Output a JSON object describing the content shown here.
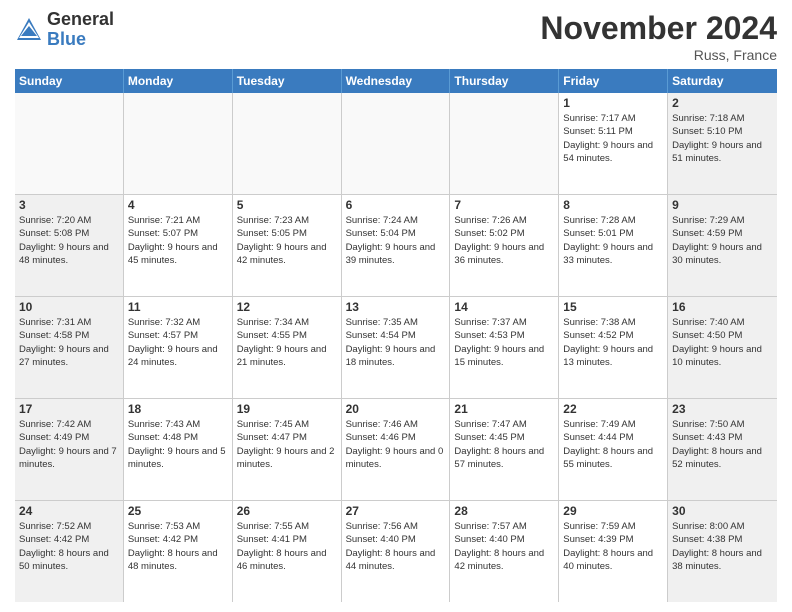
{
  "logo": {
    "general": "General",
    "blue": "Blue"
  },
  "title": "November 2024",
  "location": "Russ, France",
  "header_days": [
    "Sunday",
    "Monday",
    "Tuesday",
    "Wednesday",
    "Thursday",
    "Friday",
    "Saturday"
  ],
  "rows": [
    [
      {
        "day": "",
        "sunrise": "",
        "sunset": "",
        "daylight": "",
        "empty": true
      },
      {
        "day": "",
        "sunrise": "",
        "sunset": "",
        "daylight": "",
        "empty": true
      },
      {
        "day": "",
        "sunrise": "",
        "sunset": "",
        "daylight": "",
        "empty": true
      },
      {
        "day": "",
        "sunrise": "",
        "sunset": "",
        "daylight": "",
        "empty": true
      },
      {
        "day": "",
        "sunrise": "",
        "sunset": "",
        "daylight": "",
        "empty": true
      },
      {
        "day": "1",
        "sunrise": "Sunrise: 7:17 AM",
        "sunset": "Sunset: 5:11 PM",
        "daylight": "Daylight: 9 hours and 54 minutes.",
        "empty": false
      },
      {
        "day": "2",
        "sunrise": "Sunrise: 7:18 AM",
        "sunset": "Sunset: 5:10 PM",
        "daylight": "Daylight: 9 hours and 51 minutes.",
        "empty": false
      }
    ],
    [
      {
        "day": "3",
        "sunrise": "Sunrise: 7:20 AM",
        "sunset": "Sunset: 5:08 PM",
        "daylight": "Daylight: 9 hours and 48 minutes.",
        "empty": false
      },
      {
        "day": "4",
        "sunrise": "Sunrise: 7:21 AM",
        "sunset": "Sunset: 5:07 PM",
        "daylight": "Daylight: 9 hours and 45 minutes.",
        "empty": false
      },
      {
        "day": "5",
        "sunrise": "Sunrise: 7:23 AM",
        "sunset": "Sunset: 5:05 PM",
        "daylight": "Daylight: 9 hours and 42 minutes.",
        "empty": false
      },
      {
        "day": "6",
        "sunrise": "Sunrise: 7:24 AM",
        "sunset": "Sunset: 5:04 PM",
        "daylight": "Daylight: 9 hours and 39 minutes.",
        "empty": false
      },
      {
        "day": "7",
        "sunrise": "Sunrise: 7:26 AM",
        "sunset": "Sunset: 5:02 PM",
        "daylight": "Daylight: 9 hours and 36 minutes.",
        "empty": false
      },
      {
        "day": "8",
        "sunrise": "Sunrise: 7:28 AM",
        "sunset": "Sunset: 5:01 PM",
        "daylight": "Daylight: 9 hours and 33 minutes.",
        "empty": false
      },
      {
        "day": "9",
        "sunrise": "Sunrise: 7:29 AM",
        "sunset": "Sunset: 4:59 PM",
        "daylight": "Daylight: 9 hours and 30 minutes.",
        "empty": false
      }
    ],
    [
      {
        "day": "10",
        "sunrise": "Sunrise: 7:31 AM",
        "sunset": "Sunset: 4:58 PM",
        "daylight": "Daylight: 9 hours and 27 minutes.",
        "empty": false
      },
      {
        "day": "11",
        "sunrise": "Sunrise: 7:32 AM",
        "sunset": "Sunset: 4:57 PM",
        "daylight": "Daylight: 9 hours and 24 minutes.",
        "empty": false
      },
      {
        "day": "12",
        "sunrise": "Sunrise: 7:34 AM",
        "sunset": "Sunset: 4:55 PM",
        "daylight": "Daylight: 9 hours and 21 minutes.",
        "empty": false
      },
      {
        "day": "13",
        "sunrise": "Sunrise: 7:35 AM",
        "sunset": "Sunset: 4:54 PM",
        "daylight": "Daylight: 9 hours and 18 minutes.",
        "empty": false
      },
      {
        "day": "14",
        "sunrise": "Sunrise: 7:37 AM",
        "sunset": "Sunset: 4:53 PM",
        "daylight": "Daylight: 9 hours and 15 minutes.",
        "empty": false
      },
      {
        "day": "15",
        "sunrise": "Sunrise: 7:38 AM",
        "sunset": "Sunset: 4:52 PM",
        "daylight": "Daylight: 9 hours and 13 minutes.",
        "empty": false
      },
      {
        "day": "16",
        "sunrise": "Sunrise: 7:40 AM",
        "sunset": "Sunset: 4:50 PM",
        "daylight": "Daylight: 9 hours and 10 minutes.",
        "empty": false
      }
    ],
    [
      {
        "day": "17",
        "sunrise": "Sunrise: 7:42 AM",
        "sunset": "Sunset: 4:49 PM",
        "daylight": "Daylight: 9 hours and 7 minutes.",
        "empty": false
      },
      {
        "day": "18",
        "sunrise": "Sunrise: 7:43 AM",
        "sunset": "Sunset: 4:48 PM",
        "daylight": "Daylight: 9 hours and 5 minutes.",
        "empty": false
      },
      {
        "day": "19",
        "sunrise": "Sunrise: 7:45 AM",
        "sunset": "Sunset: 4:47 PM",
        "daylight": "Daylight: 9 hours and 2 minutes.",
        "empty": false
      },
      {
        "day": "20",
        "sunrise": "Sunrise: 7:46 AM",
        "sunset": "Sunset: 4:46 PM",
        "daylight": "Daylight: 9 hours and 0 minutes.",
        "empty": false
      },
      {
        "day": "21",
        "sunrise": "Sunrise: 7:47 AM",
        "sunset": "Sunset: 4:45 PM",
        "daylight": "Daylight: 8 hours and 57 minutes.",
        "empty": false
      },
      {
        "day": "22",
        "sunrise": "Sunrise: 7:49 AM",
        "sunset": "Sunset: 4:44 PM",
        "daylight": "Daylight: 8 hours and 55 minutes.",
        "empty": false
      },
      {
        "day": "23",
        "sunrise": "Sunrise: 7:50 AM",
        "sunset": "Sunset: 4:43 PM",
        "daylight": "Daylight: 8 hours and 52 minutes.",
        "empty": false
      }
    ],
    [
      {
        "day": "24",
        "sunrise": "Sunrise: 7:52 AM",
        "sunset": "Sunset: 4:42 PM",
        "daylight": "Daylight: 8 hours and 50 minutes.",
        "empty": false
      },
      {
        "day": "25",
        "sunrise": "Sunrise: 7:53 AM",
        "sunset": "Sunset: 4:42 PM",
        "daylight": "Daylight: 8 hours and 48 minutes.",
        "empty": false
      },
      {
        "day": "26",
        "sunrise": "Sunrise: 7:55 AM",
        "sunset": "Sunset: 4:41 PM",
        "daylight": "Daylight: 8 hours and 46 minutes.",
        "empty": false
      },
      {
        "day": "27",
        "sunrise": "Sunrise: 7:56 AM",
        "sunset": "Sunset: 4:40 PM",
        "daylight": "Daylight: 8 hours and 44 minutes.",
        "empty": false
      },
      {
        "day": "28",
        "sunrise": "Sunrise: 7:57 AM",
        "sunset": "Sunset: 4:40 PM",
        "daylight": "Daylight: 8 hours and 42 minutes.",
        "empty": false
      },
      {
        "day": "29",
        "sunrise": "Sunrise: 7:59 AM",
        "sunset": "Sunset: 4:39 PM",
        "daylight": "Daylight: 8 hours and 40 minutes.",
        "empty": false
      },
      {
        "day": "30",
        "sunrise": "Sunrise: 8:00 AM",
        "sunset": "Sunset: 4:38 PM",
        "daylight": "Daylight: 8 hours and 38 minutes.",
        "empty": false
      }
    ]
  ]
}
